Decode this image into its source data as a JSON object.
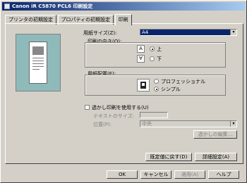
{
  "window": {
    "title": "Canon iR C5870 PCL6 印刷設定"
  },
  "tabs": [
    {
      "label": "プリンタの初期設定"
    },
    {
      "label": "プロパティの初期設定"
    },
    {
      "label": "印刷"
    }
  ],
  "print": {
    "paper_size_label": "用紙サイズ(Z):",
    "paper_size_value": "A4",
    "copies_label": "印刷の向き(O):",
    "up_label": "上",
    "down_label": "下",
    "orientation_label": "用紙配置(E):",
    "portrait_label": "プロフェッショナル",
    "landscape_label": "シンプル",
    "watermark_check_label": "透かし印刷を使用する(U)",
    "watermark_text_label": "テキストのサイズ:",
    "watermark_position_label": "位置(P):",
    "watermark_position_value": "中央",
    "watermark_edit_button": "透かしの編集...",
    "restore_default_button": "既定値に戻す(D)",
    "details_button": "詳細設定(A)"
  },
  "footer": {
    "ok": "OK",
    "cancel": "キャンセル",
    "apply": "適用(A)",
    "help": "ヘルプ"
  },
  "colors": {
    "titlebar_start": "#0a246a",
    "titlebar_end": "#a6caf0",
    "selection": "#0a246a",
    "preview_bg": "#8fbaba"
  }
}
